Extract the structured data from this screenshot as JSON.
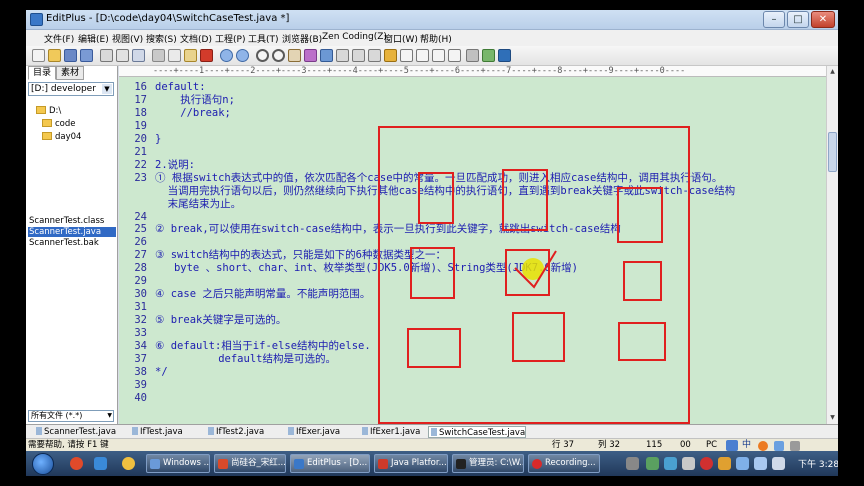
{
  "window": {
    "title": "EditPlus - [D:\\code\\day04\\SwitchCaseTest.java *]",
    "buttons": {
      "minimize": "–",
      "maximize": "□",
      "close": "✕"
    }
  },
  "menu": [
    "文件(F)",
    "编辑(E)",
    "视图(V)",
    "搜索(S)",
    "文档(D)",
    "工程(P)",
    "工具(T)",
    "浏览器(B)",
    "Zen Coding(Z)",
    "窗口(W)",
    "帮助(H)"
  ],
  "sidebar": {
    "tabs": [
      "目录",
      "素材"
    ],
    "drive": "[D:] developer",
    "tree": [
      "D:\\",
      "code",
      "day04"
    ],
    "files": [
      "ScannerTest.class",
      "ScannerTest.java",
      "ScannerTest.bak"
    ],
    "selected_file_index": 1,
    "filter": "所有文件 (*.*)"
  },
  "editor": {
    "ruler": "----+----1----+----2----+----3----+----4----+----5----+----6----+----7----+----8----+----9----+----0----",
    "lines": [
      {
        "num": "16",
        "text": "default:"
      },
      {
        "num": "17",
        "text": "    执行语句n;"
      },
      {
        "num": "18",
        "text": "    //break;"
      },
      {
        "num": "19",
        "text": ""
      },
      {
        "num": "20",
        "text": "}"
      },
      {
        "num": "21",
        "text": ""
      },
      {
        "num": "22",
        "text": "2.说明:"
      },
      {
        "num": "23",
        "text": "① 根据switch表达式中的值，依次匹配各个case中的常量。一旦匹配成功，则进入相应case结构中，调用其执行语句。"
      },
      {
        "num": "",
        "text": "  当调用完执行语句以后，则仍然继续向下执行其他case结构中的执行语句，直到遇到break关键字或此switch-case结构"
      },
      {
        "num": "",
        "text": "  末尾结束为止。"
      },
      {
        "num": "24",
        "text": ""
      },
      {
        "num": "25",
        "text": "② break,可以使用在switch-case结构中，表示一旦执行到此关键字，就跳出switch-case结构"
      },
      {
        "num": "26",
        "text": ""
      },
      {
        "num": "27",
        "text": "③ switch结构中的表达式，只能是如下的6种数据类型之一："
      },
      {
        "num": "28",
        "text": "   byte 、short、char、int、枚举类型(JDK5.0新增)、String类型(JDK7.0新增)"
      },
      {
        "num": "29",
        "text": ""
      },
      {
        "num": "30",
        "text": "④ case 之后只能声明常量。不能声明范围。"
      },
      {
        "num": "31",
        "text": ""
      },
      {
        "num": "32",
        "text": "⑤ break关键字是可选的。"
      },
      {
        "num": "33",
        "text": ""
      },
      {
        "num": "34",
        "text": "⑥ default:相当于if-else结构中的else."
      },
      {
        "num": "37",
        "text": "          default结构是可选的。"
      },
      {
        "num": "38",
        "text": "*/"
      },
      {
        "num": "39",
        "text": ""
      },
      {
        "num": "40",
        "text": ""
      }
    ]
  },
  "doc_tabs": [
    "ScannerTest.java",
    "IfTest.java",
    "IfTest2.java",
    "IfExer.java",
    "IfExer1.java",
    "SwitchCaseTest.java"
  ],
  "active_doc_tab": 5,
  "status": {
    "help": "需要帮助, 请按 F1 键",
    "line": "行 37",
    "col": "列 32",
    "chars": "115",
    "ins": "00",
    "mode": "PC"
  },
  "taskbar": {
    "tasks": [
      "Windows ...",
      "尚硅谷_宋红...",
      "EditPlus - [D...",
      "Java Platfor...",
      "管理员: C:\\W...",
      "Recording..."
    ],
    "clock": "下午 3:28"
  },
  "colors": {
    "editor_bg": "#cde8cf",
    "code_text": "#1c1cb0",
    "annotation_red": "#e0201f",
    "highlight_yellow": "#e8e200"
  }
}
